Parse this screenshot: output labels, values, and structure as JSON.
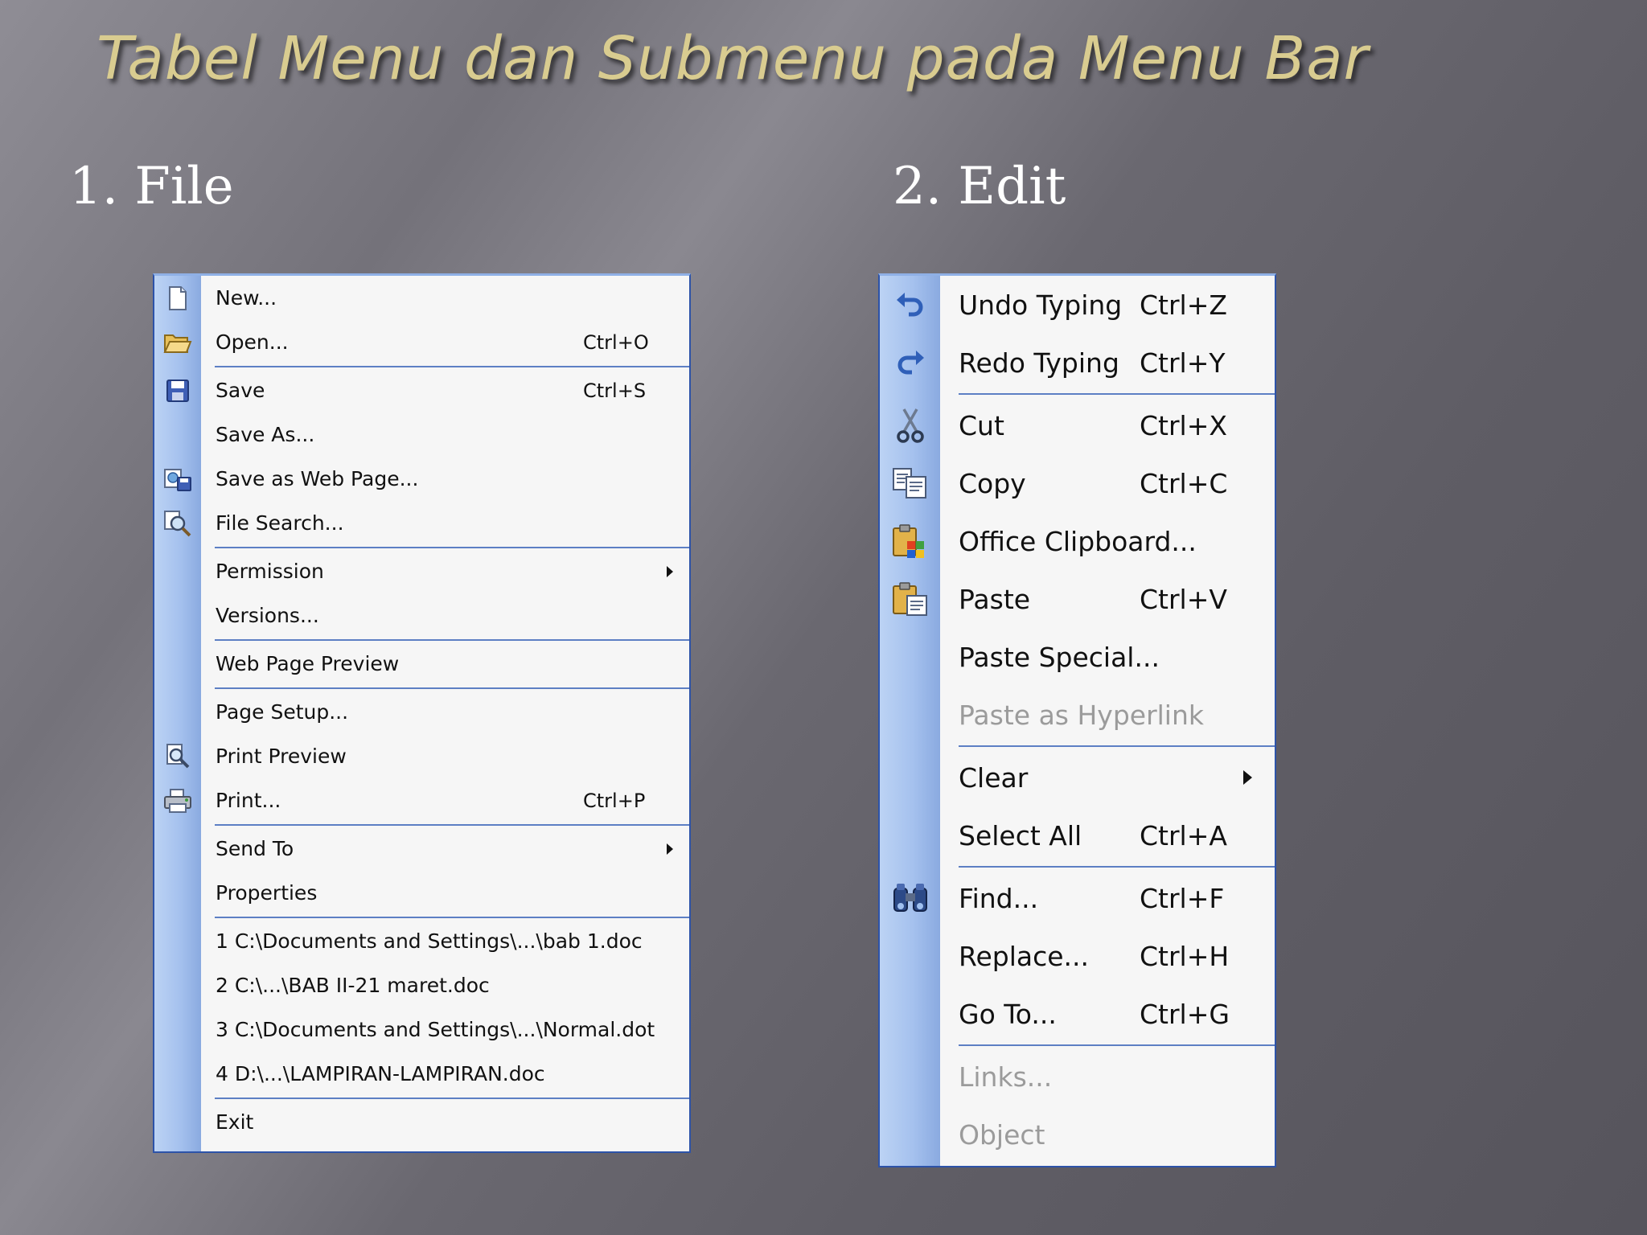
{
  "slide": {
    "title": "Tabel Menu dan Submenu pada Menu Bar",
    "file_heading": "1. File",
    "edit_heading": "2. Edit"
  },
  "file_menu": {
    "items": [
      {
        "label": "New...",
        "shortcut": "",
        "icon": "new-document-icon"
      },
      {
        "label": "Open...",
        "shortcut": "Ctrl+O",
        "icon": "open-folder-icon"
      },
      {
        "label": "Save",
        "shortcut": "Ctrl+S",
        "icon": "save-disk-icon"
      },
      {
        "label": "Save As...",
        "shortcut": "",
        "icon": ""
      },
      {
        "label": "Save as Web Page...",
        "shortcut": "",
        "icon": "save-web-page-icon"
      },
      {
        "label": "File Search...",
        "shortcut": "",
        "icon": "file-search-icon"
      },
      {
        "label": "Permission",
        "shortcut": "",
        "icon": "",
        "submenu": true
      },
      {
        "label": "Versions...",
        "shortcut": "",
        "icon": ""
      },
      {
        "label": "Web Page Preview",
        "shortcut": "",
        "icon": ""
      },
      {
        "label": "Page Setup...",
        "shortcut": "",
        "icon": ""
      },
      {
        "label": "Print Preview",
        "shortcut": "",
        "icon": "print-preview-icon"
      },
      {
        "label": "Print...",
        "shortcut": "Ctrl+P",
        "icon": "printer-icon"
      },
      {
        "label": "Send To",
        "shortcut": "",
        "icon": "",
        "submenu": true
      },
      {
        "label": "Properties",
        "shortcut": "",
        "icon": ""
      },
      {
        "label": "1 C:\\Documents and Settings\\...\\bab 1.doc",
        "shortcut": "",
        "icon": ""
      },
      {
        "label": "2 C:\\...\\BAB II-21 maret.doc",
        "shortcut": "",
        "icon": ""
      },
      {
        "label": "3 C:\\Documents and Settings\\...\\Normal.dot",
        "shortcut": "",
        "icon": ""
      },
      {
        "label": "4 D:\\...\\LAMPIRAN-LAMPIRAN.doc",
        "shortcut": "",
        "icon": ""
      },
      {
        "label": "Exit",
        "shortcut": "",
        "icon": ""
      }
    ]
  },
  "edit_menu": {
    "items": [
      {
        "label": "Undo Typing",
        "shortcut": "Ctrl+Z",
        "icon": "undo-icon"
      },
      {
        "label": "Redo Typing",
        "shortcut": "Ctrl+Y",
        "icon": "redo-icon"
      },
      {
        "label": "Cut",
        "shortcut": "Ctrl+X",
        "icon": "scissors-icon"
      },
      {
        "label": "Copy",
        "shortcut": "Ctrl+C",
        "icon": "copy-icon"
      },
      {
        "label": "Office Clipboard...",
        "shortcut": "",
        "icon": "office-clipboard-icon"
      },
      {
        "label": "Paste",
        "shortcut": "Ctrl+V",
        "icon": "paste-icon"
      },
      {
        "label": "Paste Special...",
        "shortcut": "",
        "icon": ""
      },
      {
        "label": "Paste as Hyperlink",
        "shortcut": "",
        "icon": "",
        "disabled": true
      },
      {
        "label": "Clear",
        "shortcut": "",
        "icon": "",
        "submenu": true
      },
      {
        "label": "Select All",
        "shortcut": "Ctrl+A",
        "icon": ""
      },
      {
        "label": "Find...",
        "shortcut": "Ctrl+F",
        "icon": "binoculars-icon"
      },
      {
        "label": "Replace...",
        "shortcut": "Ctrl+H",
        "icon": ""
      },
      {
        "label": "Go To...",
        "shortcut": "Ctrl+G",
        "icon": ""
      },
      {
        "label": "Links...",
        "shortcut": "",
        "icon": "",
        "disabled": true
      },
      {
        "label": "Object",
        "shortcut": "",
        "icon": "",
        "disabled": true
      }
    ]
  }
}
